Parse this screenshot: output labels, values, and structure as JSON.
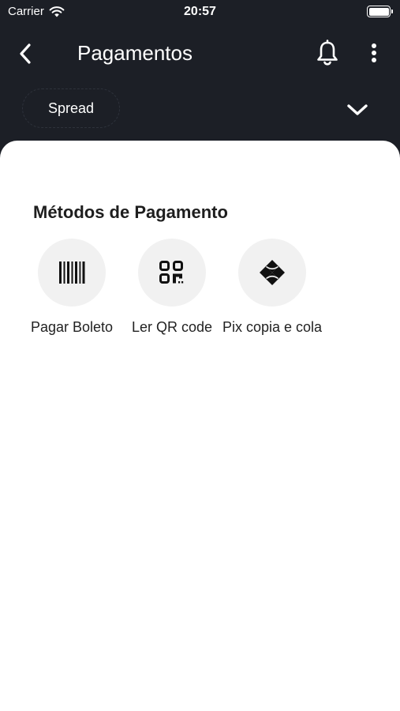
{
  "status_bar": {
    "carrier": "Carrier",
    "time": "20:57",
    "icons": [
      "wifi-icon",
      "battery-icon"
    ]
  },
  "header": {
    "title": "Pagamentos",
    "icons": [
      "back-arrow-icon",
      "bell-icon",
      "more-vertical-icon"
    ]
  },
  "account_selector": {
    "label": "Spread",
    "icon": "chevron-down-icon"
  },
  "payment_methods": {
    "title": "Métodos de Pagamento",
    "items": [
      {
        "label": "Pagar Boleto",
        "icon": "barcode-icon"
      },
      {
        "label": "Ler QR code",
        "icon": "qr-code-icon"
      },
      {
        "label": "Pix copia e cola",
        "icon": "pix-icon"
      }
    ]
  },
  "colors": {
    "header_bg": "#1c1f26",
    "sheet_bg": "#ffffff",
    "icon_circle_bg": "#f1f1f1",
    "text_dark": "#1e1e1e"
  }
}
